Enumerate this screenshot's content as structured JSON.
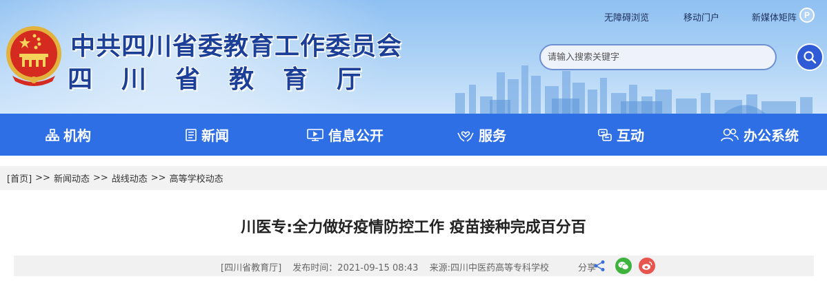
{
  "header": {
    "org_name": "中共四川省委教育工作委员会",
    "dept_name": "四川省教育厅",
    "top_links": [
      "无障碍浏览",
      "移动门户",
      "新媒体矩阵"
    ],
    "search": {
      "placeholder": "请输入搜索关键字"
    }
  },
  "nav": {
    "items": [
      {
        "label": "机构",
        "icon": "org-chart-icon"
      },
      {
        "label": "新闻",
        "icon": "news-icon"
      },
      {
        "label": "信息公开",
        "icon": "monitor-icon"
      },
      {
        "label": "服务",
        "icon": "hands-service-icon"
      },
      {
        "label": "互动",
        "icon": "chat-icon"
      },
      {
        "label": "办公系统",
        "icon": "users-icon"
      }
    ]
  },
  "breadcrumb": {
    "items": [
      "[首页]",
      "新闻动态",
      "战线动态",
      "高等学校动态"
    ],
    "separator": ">>"
  },
  "article": {
    "title": "川医专:全力做好疫情防控工作 疫苗接种完成百分百",
    "source_tag": "[四川省教育厅]",
    "publish_time": "发布时间：2021-09-15 08:43",
    "origin": "来源:四川中医药高等专科学校",
    "share_label": "分享"
  },
  "colors": {
    "nav_bg": "#2f6fe6",
    "title_blue": "#1c3f98",
    "wechat": "#3db33d",
    "weibo": "#e8554e"
  }
}
